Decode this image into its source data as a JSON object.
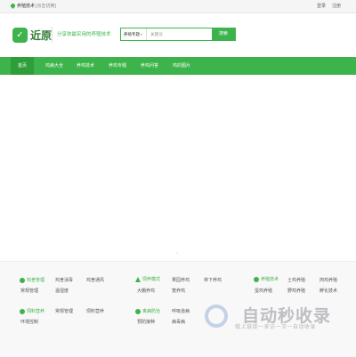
{
  "topbar": {
    "location": "养殖技术",
    "switch_label": "[点击切换]",
    "login": "登录",
    "register": "注册"
  },
  "header": {
    "logo_text": "近原",
    "slogan": "分享你最实用的养殖技术",
    "search_category": "养殖专题",
    "search_placeholder": "关键词",
    "search_button": "搜索"
  },
  "nav": {
    "items": [
      "首页",
      "鸡病大全",
      "养鸡技术",
      "养鸡专题",
      "养鸡问答",
      "鸡的图片"
    ]
  },
  "pager": "<",
  "footer": {
    "sections": [
      {
        "title": "鸡舍管理",
        "links": [
          "鸡舍消毒",
          "鸡舍通风",
          "常规管理",
          "温湿度"
        ]
      },
      {
        "title": "饲养模式",
        "links": [
          "果园养鸡",
          "林下养鸡",
          "大棚养鸡",
          "笼养鸡"
        ]
      },
      {
        "title": "养殖技术",
        "links": [
          "土鸡养殖",
          "肉鸡养殖",
          "蛋鸡养殖",
          "野鸡养殖",
          "孵化技术"
        ]
      },
      {
        "title": "饲料营养",
        "links": [
          "常规管理",
          "饲料营养",
          "环境控制"
        ]
      },
      {
        "title": "禽病防治",
        "links": [
          "呼吸道病",
          "预防接种",
          "病毒病"
        ]
      }
    ]
  },
  "watermark": {
    "title": "自动秒收录",
    "subtitle": "做上链接一来访一次一自动收录"
  },
  "colors": {
    "brand": "#3cb44b",
    "brand_dark": "#2e9e3a"
  }
}
